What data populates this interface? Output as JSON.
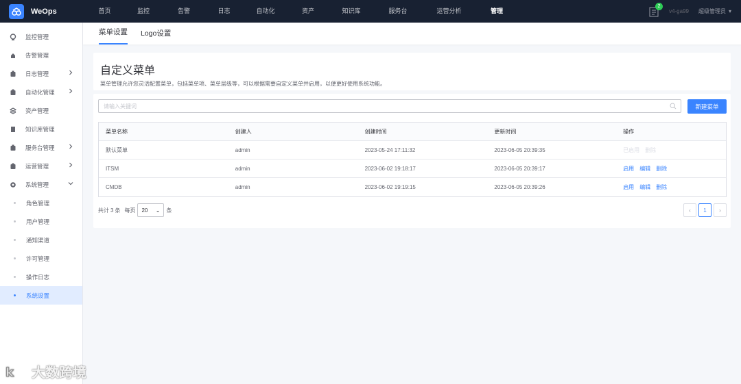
{
  "app": {
    "name": "WeOps"
  },
  "nav": [
    "首页",
    "监控",
    "告警",
    "日志",
    "自动化",
    "资产",
    "知识库",
    "服务台",
    "运营分析",
    "管理"
  ],
  "nav_active": 9,
  "top_right": {
    "badge": "2",
    "version": "v4-ga99",
    "user": "超级管理员"
  },
  "sidebar": {
    "items": [
      {
        "label": "监控管理",
        "icon": "monitor-icon",
        "arrow": false
      },
      {
        "label": "告警管理",
        "icon": "alarm-icon",
        "arrow": false
      },
      {
        "label": "日志管理",
        "icon": "log-icon",
        "arrow": true
      },
      {
        "label": "自动化管理",
        "icon": "automation-icon",
        "arrow": true
      },
      {
        "label": "资产管理",
        "icon": "asset-icon",
        "arrow": false
      },
      {
        "label": "知识库管理",
        "icon": "book-icon",
        "arrow": false
      },
      {
        "label": "服务台管理",
        "icon": "service-icon",
        "arrow": true
      },
      {
        "label": "运营管理",
        "icon": "ops-icon",
        "arrow": true
      },
      {
        "label": "系统管理",
        "icon": "gear-icon",
        "arrow": true
      }
    ],
    "sub_items": [
      "角色管理",
      "用户管理",
      "通知渠道",
      "许可管理",
      "操作日志",
      "系统设置"
    ],
    "sub_active": 5
  },
  "tabs": [
    "菜单设置",
    "Logo设置"
  ],
  "intro": {
    "title": "自定义菜单",
    "desc": "菜单管理允许您灵活配置菜单，包括菜单项、菜单层级等，可以根据需要自定义菜单并启用，以便更好使用系统功能。"
  },
  "search": {
    "placeholder": "请输入关键词"
  },
  "new_button": "新建菜单",
  "table": {
    "headers": [
      "菜单名称",
      "创建人",
      "创建时间",
      "更新时间",
      "操作"
    ],
    "rows": [
      {
        "name": "默认菜单",
        "creator": "admin",
        "created": "2023-05-24 17:11:32",
        "updated": "2023-06-05 20:39:35",
        "actions": [
          "已启用",
          "删除"
        ],
        "disabled": true
      },
      {
        "name": "ITSM",
        "creator": "admin",
        "created": "2023-06-02 19:18:17",
        "updated": "2023-06-05 20:39:17",
        "actions": [
          "启用",
          "编辑",
          "删除"
        ],
        "disabled": false
      },
      {
        "name": "CMDB",
        "creator": "admin",
        "created": "2023-06-02 19:19:15",
        "updated": "2023-06-05 20:39:26",
        "actions": [
          "启用",
          "编辑",
          "删除"
        ],
        "disabled": false
      }
    ]
  },
  "pager": {
    "total_prefix": "共计",
    "total": "3",
    "total_suffix": "条",
    "per_page_label": "每页",
    "per_page": "20",
    "per_page_suffix": "条",
    "current_page": "1"
  },
  "watermark": "大数跨境",
  "colors": {
    "primary": "#3a84ff",
    "topbar": "#182132",
    "badge": "#2dcb56"
  }
}
